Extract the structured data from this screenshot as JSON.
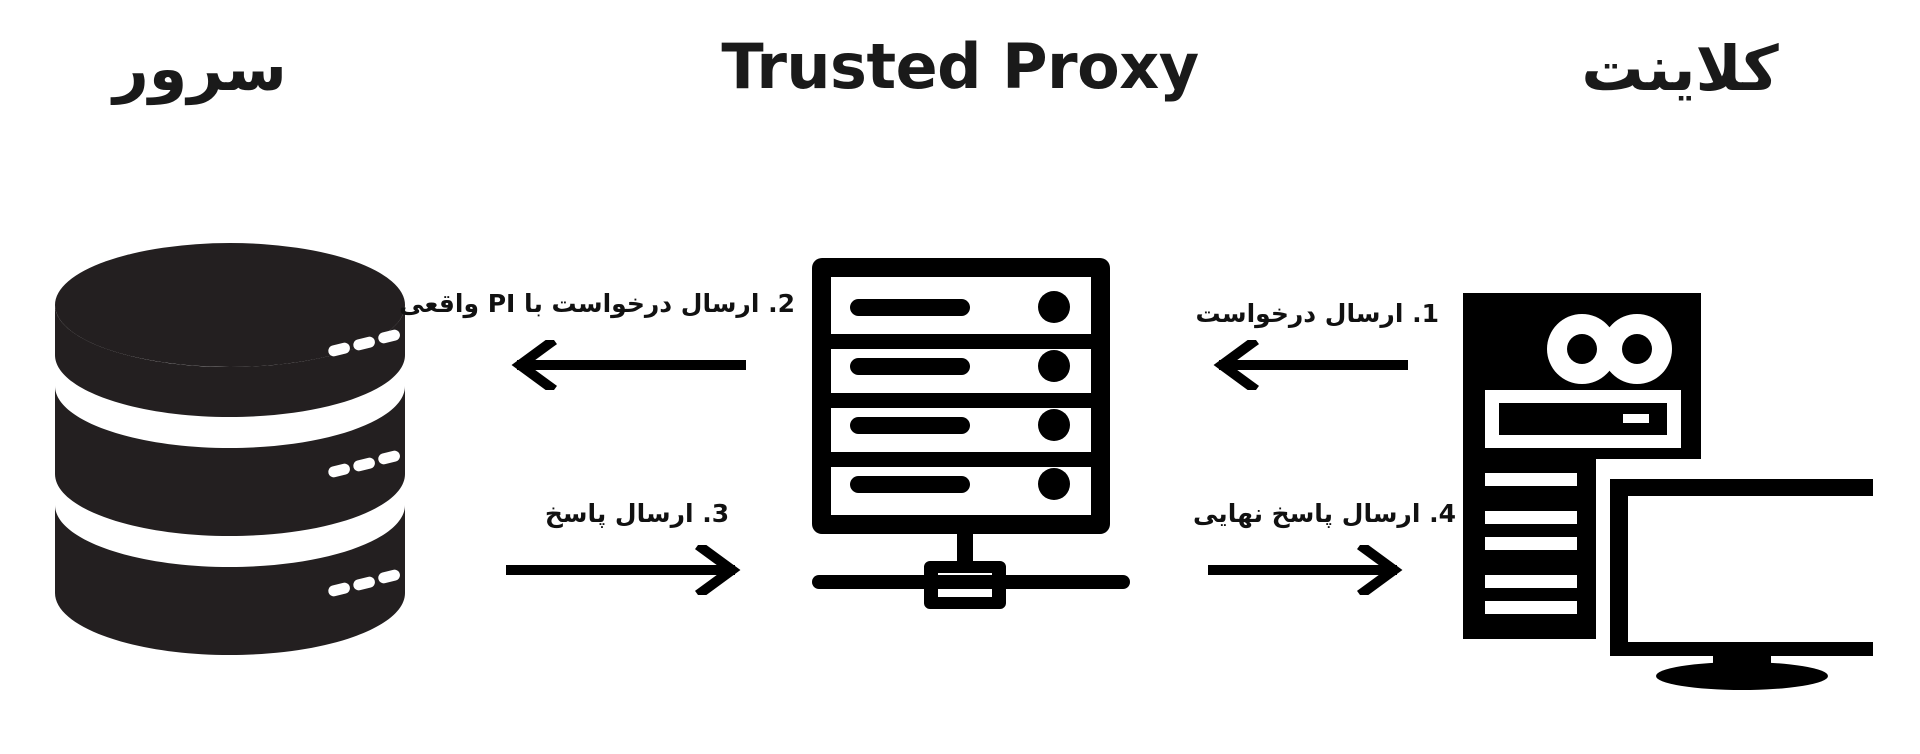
{
  "diagram": {
    "background_color": "#ffffff",
    "ink_color": "#111111",
    "database_color": "#231f20",
    "columns": [
      {
        "key": "server",
        "title": "سرور",
        "icon": "database-cylinder-icon"
      },
      {
        "key": "proxy",
        "title": "Trusted Proxy",
        "icon": "server-rack-icon"
      },
      {
        "key": "client",
        "title": "کلاینت",
        "icon": "desktop-computer-icon"
      }
    ],
    "flows": [
      {
        "step": "1",
        "label": "1.  ارسال درخواست",
        "direction": "left",
        "from": "client",
        "to": "proxy"
      },
      {
        "step": "2",
        "label": "2.  ارسال درخواست با IP واقعی",
        "direction": "left",
        "from": "proxy",
        "to": "server"
      },
      {
        "step": "3",
        "label": "3.  ارسال پاسخ",
        "direction": "right",
        "from": "server",
        "to": "proxy"
      },
      {
        "step": "4",
        "label": "4.  ارسال پاسخ نهایی",
        "direction": "right",
        "from": "proxy",
        "to": "client"
      }
    ]
  }
}
